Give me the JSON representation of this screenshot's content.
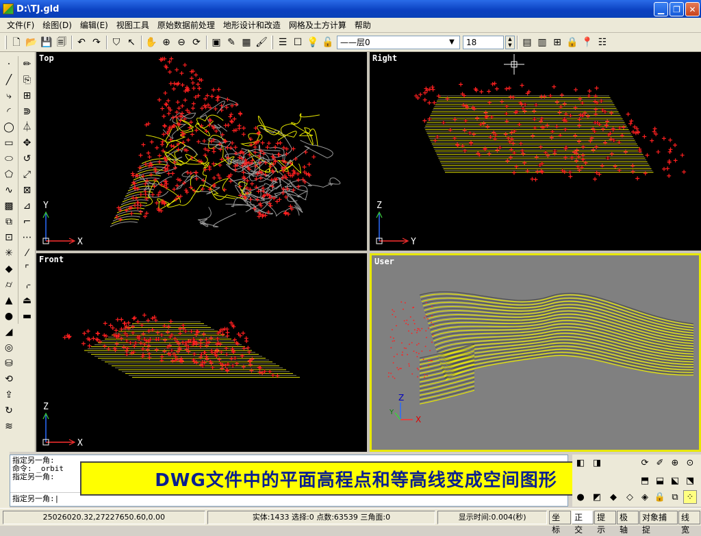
{
  "window": {
    "title": "D:\\TJ.gld"
  },
  "menu": [
    "文件(F)",
    "绘图(D)",
    "编辑(E)",
    "视图工具",
    "原始数据前处理",
    "地形设计和改造",
    "网格及土方计算",
    "帮助"
  ],
  "toolbar": {
    "layer_name": "层0",
    "layer_linetype": "——",
    "number_value": "18"
  },
  "viewports": {
    "top": {
      "label": "Top",
      "axis_v": "Y",
      "axis_h": "X"
    },
    "right": {
      "label": "Right",
      "axis_v": "Z",
      "axis_h": "Y"
    },
    "front": {
      "label": "Front",
      "axis_v": "Z",
      "axis_h": "X"
    },
    "user": {
      "label": "User",
      "axis_v": "Z",
      "axis_h": "X",
      "axis_d": "Y"
    }
  },
  "command": {
    "lines": [
      "指定另一角:",
      "命令: _orbit",
      "指定另一角:"
    ],
    "prompt": "指定另一角:"
  },
  "caption": "DWG文件中的平面高程点和等高线变成空间图形",
  "status": {
    "coords": "25026020.32,27227650.60,0.00",
    "stats": "实体:1433 选择:0 点数:63539 三角面:0",
    "time": "显示时间:0.004(秒)",
    "toggles": [
      {
        "label": "坐标",
        "on": false
      },
      {
        "label": "正交",
        "on": true
      },
      {
        "label": "提示",
        "on": false
      },
      {
        "label": "极轴",
        "on": false
      },
      {
        "label": "对象捕捉",
        "on": false
      },
      {
        "label": "线宽",
        "on": false
      }
    ]
  },
  "colors": {
    "points": "#ff2020",
    "contour_main": "#e8e800",
    "contour_minor": "#9a9a9a",
    "user_bg": "#808080",
    "active_border": "#e8e800"
  }
}
